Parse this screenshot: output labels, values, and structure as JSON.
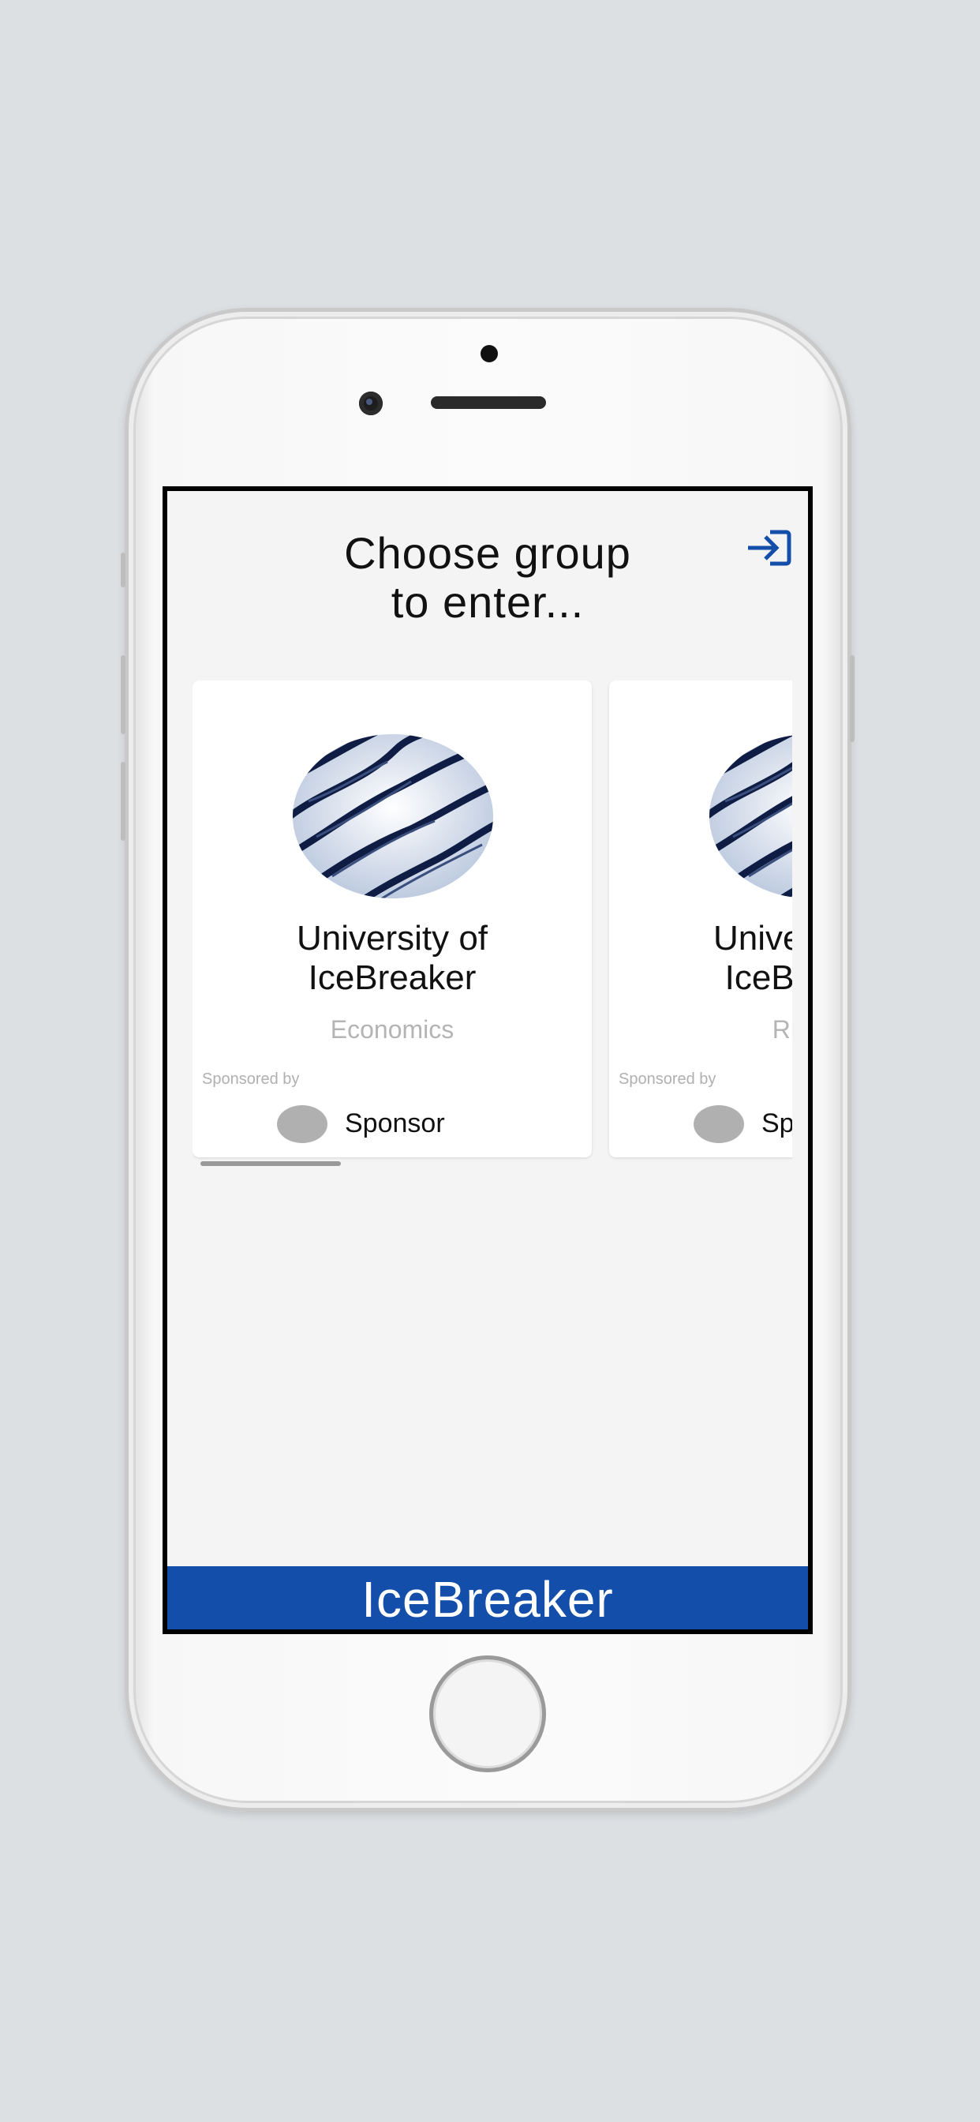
{
  "header": {
    "title": "Choose group\nto enter..."
  },
  "icons": {
    "logout": "logout-arrow-icon",
    "accent": "#134eaa"
  },
  "groups": [
    {
      "name": "University of\nIceBreaker",
      "category": "Economics",
      "sponsored_label": "Sponsored by",
      "sponsor": "Sponsor"
    },
    {
      "name": "University of\nIceBreaker",
      "category": "Rugby",
      "sponsored_label": "Sponsored by",
      "sponsor": "Sponsor"
    }
  ],
  "footer": {
    "brand": "IceBreaker",
    "color": "#134eaa"
  }
}
